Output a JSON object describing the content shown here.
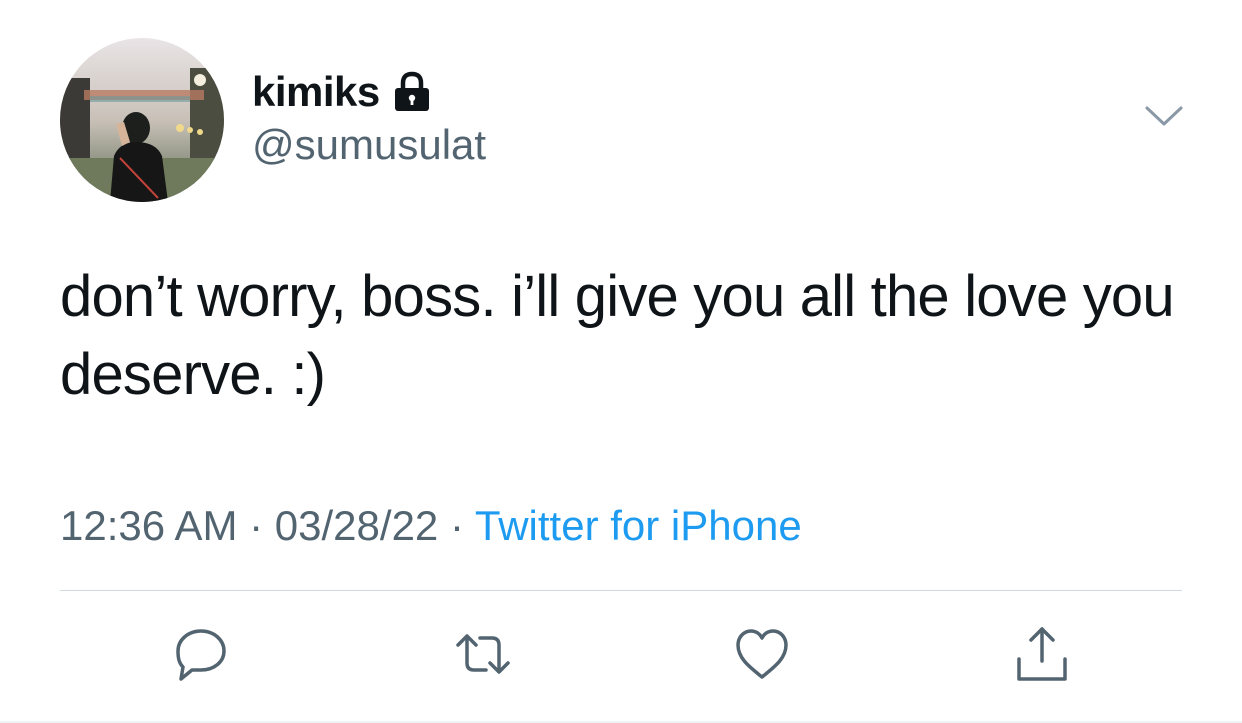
{
  "author": {
    "display_name": "kimiks",
    "handle": "@sumusulat",
    "protected_icon": "lock-icon",
    "avatar": "profile-photo"
  },
  "tweet": {
    "text": "don’t worry, boss. i’ll give you all the love you deserve. :)"
  },
  "meta": {
    "time": "12:36 AM",
    "separator_1": " · ",
    "date": "03/28/22",
    "separator_2": " · ",
    "source": "Twitter for iPhone"
  },
  "actions": {
    "reply_icon": "reply-icon",
    "retweet_icon": "retweet-icon",
    "like_icon": "heart-icon",
    "share_icon": "share-icon"
  },
  "colors": {
    "text": "#0f1419",
    "secondary": "#536471",
    "link": "#1d9bf0",
    "divider": "#cfd9de"
  }
}
